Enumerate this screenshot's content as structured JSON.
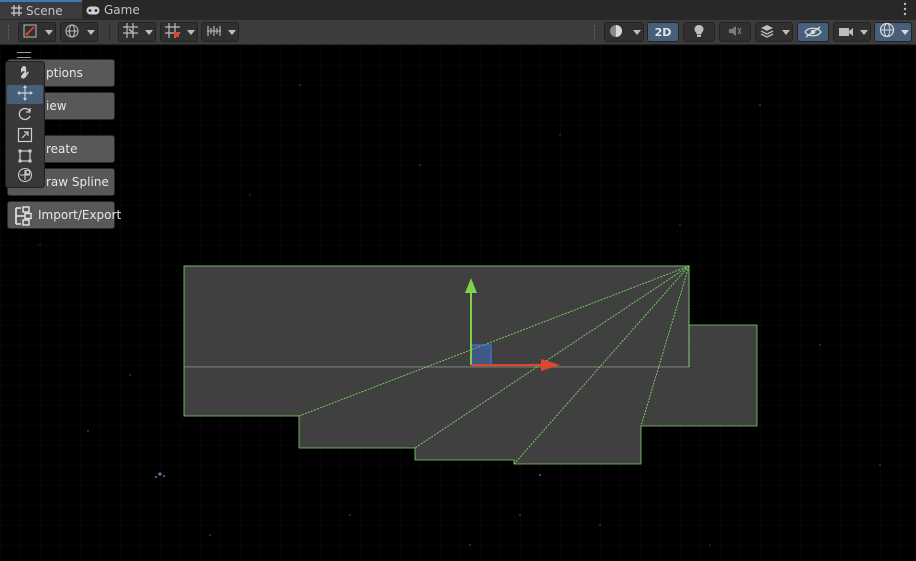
{
  "tabs": [
    {
      "label": "Scene",
      "icon": "hash-grid-icon",
      "active": true
    },
    {
      "label": "Game",
      "icon": "gamepad-icon",
      "active": false
    }
  ],
  "toolbar": {
    "toggle_2d_label": "2D",
    "buttons": [
      "gizmo-tools-icon",
      "global-local-icon",
      "grid-snap-icon",
      "increment-snap-icon",
      "vertex-snap-icon",
      "draw-mode-icon",
      "toggle-2d",
      "lighting-icon",
      "audio-icon",
      "effects-icon",
      "scene-visibility-icon",
      "camera-icon",
      "gizmos-icon"
    ]
  },
  "overlay_menu": {
    "items": [
      {
        "label": "ptions",
        "full": "Options"
      },
      {
        "label": "iew",
        "full": "View"
      },
      {
        "label": "reate",
        "full": "Create"
      },
      {
        "label": "raw Spline",
        "full": "Draw Spline"
      },
      {
        "label": "Import/Export",
        "full": "Import/Export"
      }
    ]
  },
  "tool_palette": {
    "tools": [
      "hand-icon",
      "move-icon",
      "rotate-icon",
      "scale-icon",
      "rect-transform-icon",
      "transform-icon"
    ],
    "selected": "move-icon"
  },
  "colors": {
    "mesh_fill": "#404040",
    "mesh_edge": "#7fd86a",
    "axis_x": "#e0452f",
    "axis_y": "#7cd34a",
    "axis_z": "#3f78d8",
    "selected_button": "#46607c"
  }
}
